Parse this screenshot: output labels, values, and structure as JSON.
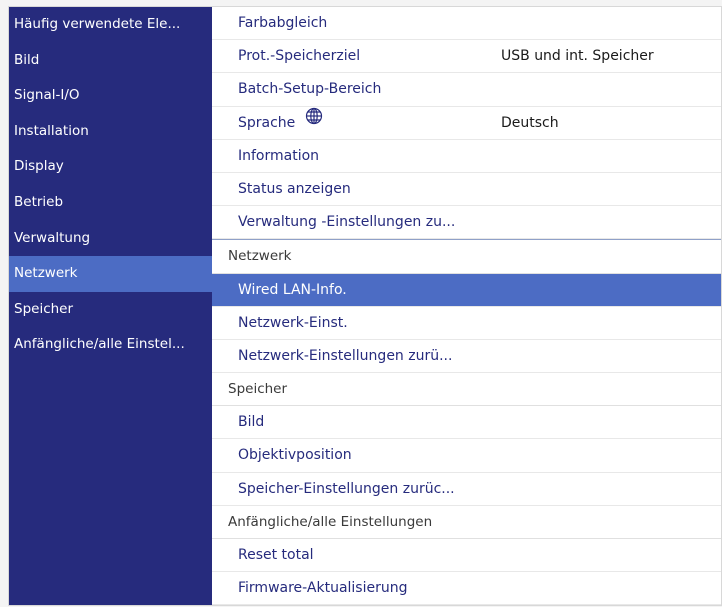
{
  "sidebar": {
    "items": [
      {
        "label": "Häufig verwendete Ele..."
      },
      {
        "label": "Bild"
      },
      {
        "label": "Signal-I/O"
      },
      {
        "label": "Installation"
      },
      {
        "label": "Display"
      },
      {
        "label": "Betrieb"
      },
      {
        "label": "Verwaltung"
      },
      {
        "label": "Netzwerk"
      },
      {
        "label": "Speicher"
      },
      {
        "label": "Anfängliche/alle Einstel..."
      }
    ],
    "active_index": 7
  },
  "main": {
    "farbabgleich": "Farbabgleich",
    "prot_speicherziel": {
      "label": "Prot.-Speicherziel",
      "value": "USB und int. Speicher"
    },
    "batch_setup": "Batch-Setup-Bereich",
    "sprache": {
      "label": "Sprache",
      "value": "Deutsch",
      "icon": "globe-icon"
    },
    "information": "Information",
    "status_anzeigen": "Status anzeigen",
    "verwaltung_reset": "Verwaltung -Einstellungen zu...",
    "netzwerk_header": "Netzwerk",
    "wired_lan_info": "Wired LAN-Info.",
    "netzwerk_einst": "Netzwerk-Einst.",
    "netzwerk_reset": "Netzwerk-Einstellungen zurü...",
    "speicher_header": "Speicher",
    "bild": "Bild",
    "objektivposition": "Objektivposition",
    "speicher_reset": "Speicher-Einstellungen zurüc...",
    "anfaengliche_header": "Anfängliche/alle Einstellungen",
    "reset_total": "Reset total",
    "firmware": "Firmware-Aktualisierung"
  },
  "colors": {
    "sidebar_bg": "#262b7d",
    "highlight": "#4c6cc4",
    "item_text": "#262b7d"
  }
}
